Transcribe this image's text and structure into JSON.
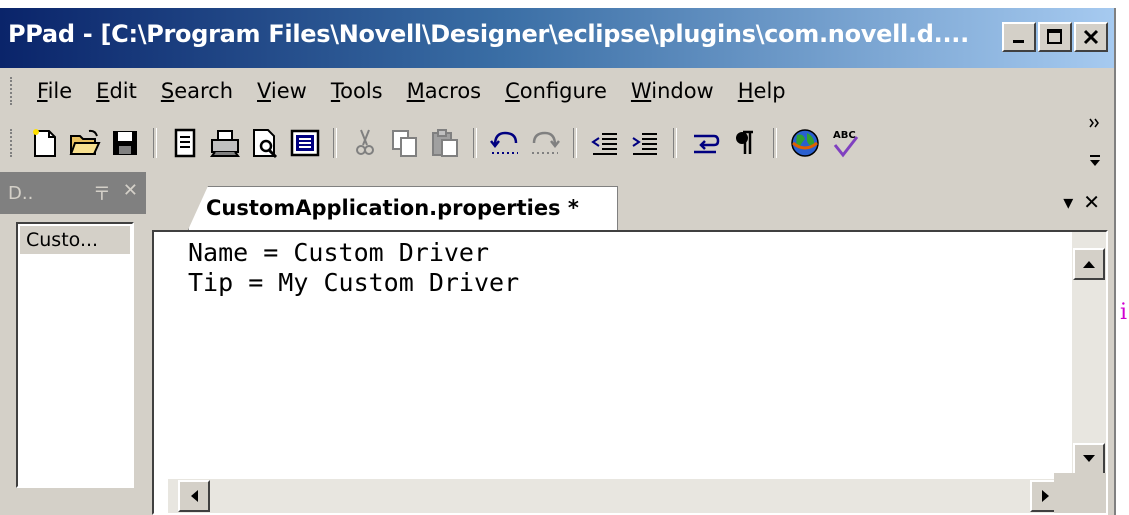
{
  "window": {
    "title": "PPad - [C:\\Program Files\\Novell\\Designer\\eclipse\\plugins\\com.novell.d....",
    "controls": [
      "minimize",
      "maximize",
      "close"
    ]
  },
  "menu": [
    {
      "label": "File",
      "mnemonic": "F",
      "rest": "ile"
    },
    {
      "label": "Edit",
      "mnemonic": "E",
      "rest": "dit"
    },
    {
      "label": "Search",
      "mnemonic": "S",
      "rest": "earch"
    },
    {
      "label": "View",
      "mnemonic": "V",
      "rest": "iew"
    },
    {
      "label": "Tools",
      "mnemonic": "T",
      "rest": "ools"
    },
    {
      "label": "Macros",
      "mnemonic": "M",
      "rest": "acros"
    },
    {
      "label": "Configure",
      "mnemonic": "C",
      "rest": "onfigure"
    },
    {
      "label": "Window",
      "mnemonic": "W",
      "rest": "indow"
    },
    {
      "label": "Help",
      "mnemonic": "H",
      "rest": "elp"
    }
  ],
  "toolbar": {
    "icons": [
      "new-file-icon",
      "open-folder-icon",
      "save-icon",
      "properties-icon",
      "print-icon",
      "print-preview-icon",
      "page-setup-icon",
      "cut-icon",
      "copy-icon",
      "paste-icon",
      "undo-icon",
      "redo-icon",
      "outdent-icon",
      "indent-icon",
      "word-wrap-icon",
      "pilcrow-icon",
      "globe-icon",
      "spellcheck-icon"
    ]
  },
  "left_panel": {
    "title": "D..",
    "pin_glyph": "〒",
    "close_glyph": "✕",
    "items": [
      "Custo..."
    ]
  },
  "editor": {
    "tab_label": "CustomApplication.properties *",
    "tab_dropdown": "▾",
    "tab_close": "✕",
    "lines": [
      "Name = Custom Driver",
      "Tip = My Custom Driver"
    ]
  },
  "outside_glyph": "i",
  "colors": {
    "title_start": "#0a246a",
    "title_end": "#a6caf0",
    "chrome": "#d4d0c8"
  }
}
